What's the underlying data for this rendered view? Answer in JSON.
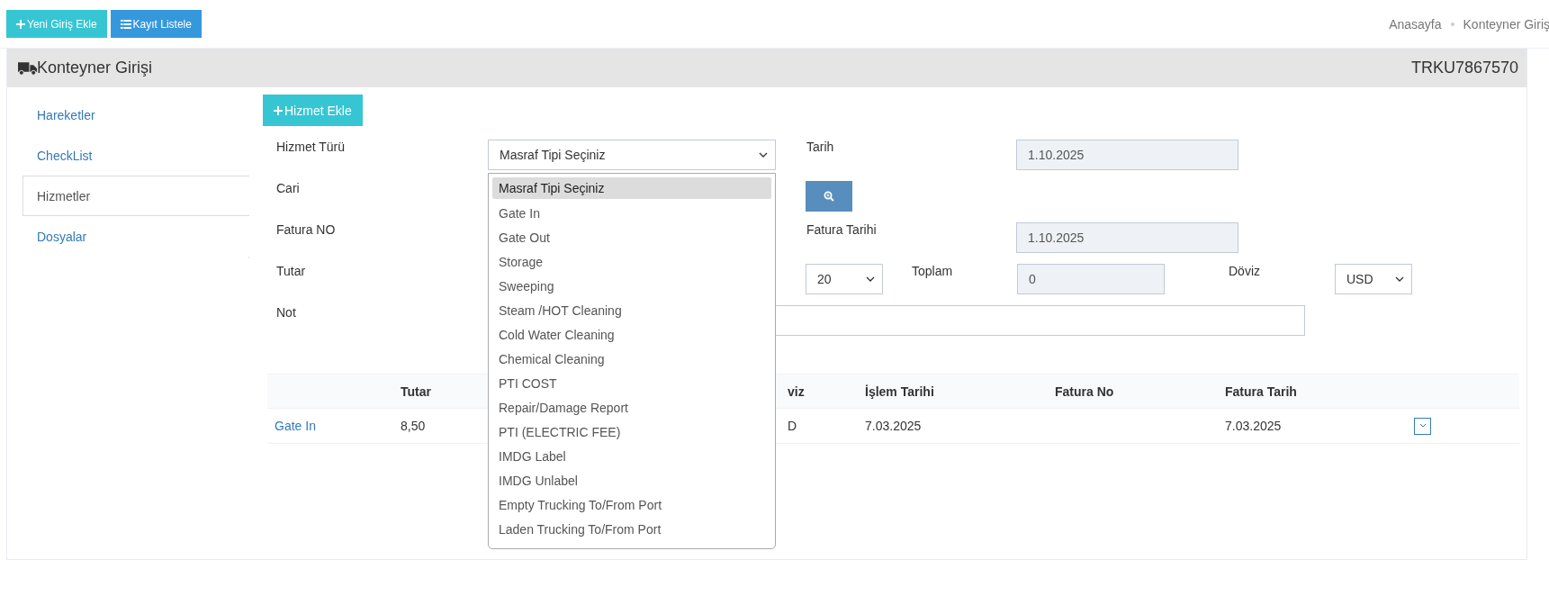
{
  "top_buttons": [
    {
      "label": "Yeni Giriş Ekle",
      "kind": "teal"
    },
    {
      "label": "Kayıt Listele",
      "kind": "blue"
    }
  ],
  "breadcrumb": [
    "Anasayfa",
    "Konteyner Giriş"
  ],
  "panel": {
    "title": "Konteyner Girişi",
    "container_no": "TRKU7867570"
  },
  "sidebar": {
    "items": [
      {
        "label": "Hareketler",
        "selected": false
      },
      {
        "label": "CheckList",
        "selected": false
      },
      {
        "label": "Hizmetler",
        "selected": true
      },
      {
        "label": "Dosyalar",
        "selected": false
      }
    ]
  },
  "add_button": {
    "label": "Hizmet Ekle"
  },
  "form": {
    "hizmet_turu": {
      "label": "Hizmet Türü",
      "value": "Masraf Tipi Seçiniz",
      "expanded": true,
      "options": [
        {
          "label": "Masraf Tipi Seçiniz",
          "selected": true
        },
        {
          "label": "Gate In",
          "selected": false
        },
        {
          "label": "Gate Out",
          "selected": false
        },
        {
          "label": "Storage",
          "selected": false
        },
        {
          "label": "Sweeping",
          "selected": false
        },
        {
          "label": "Steam /HOT Cleaning",
          "selected": false
        },
        {
          "label": "Cold Water Cleaning",
          "selected": false
        },
        {
          "label": "Chemical Cleaning",
          "selected": false
        },
        {
          "label": "PTI COST",
          "selected": false
        },
        {
          "label": "Repair/Damage Report",
          "selected": false
        },
        {
          "label": "PTI (ELECTRIC FEE)",
          "selected": false
        },
        {
          "label": "IMDG Label",
          "selected": false
        },
        {
          "label": "IMDG Unlabel",
          "selected": false
        },
        {
          "label": "Empty Trucking To/From Port",
          "selected": false
        },
        {
          "label": "Laden Trucking To/From Port",
          "selected": false
        }
      ]
    },
    "tarih": {
      "label": "Tarih",
      "value": "1.10.2025"
    },
    "cari": {
      "label": "Cari"
    },
    "fatura_no": {
      "label": "Fatura NO"
    },
    "fatura_tarihi": {
      "label": "Fatura Tarihi",
      "value": "1.10.2025"
    },
    "tutar": {
      "label": "Tutar"
    },
    "kdv": {
      "value": "20"
    },
    "toplam": {
      "label": "Toplam",
      "value": "0"
    },
    "doviz": {
      "label": "Döviz",
      "value": "USD"
    },
    "not": {
      "label": "Not"
    }
  },
  "table": {
    "columns": [
      "",
      "Tutar",
      "viz",
      "İşlem Tarihi",
      "Fatura No",
      "Fatura Tarih",
      ""
    ],
    "rows": [
      {
        "cells": [
          "Gate In",
          "8,50",
          "D",
          "7.03.2025",
          "",
          "7.03.2025"
        ]
      }
    ]
  }
}
